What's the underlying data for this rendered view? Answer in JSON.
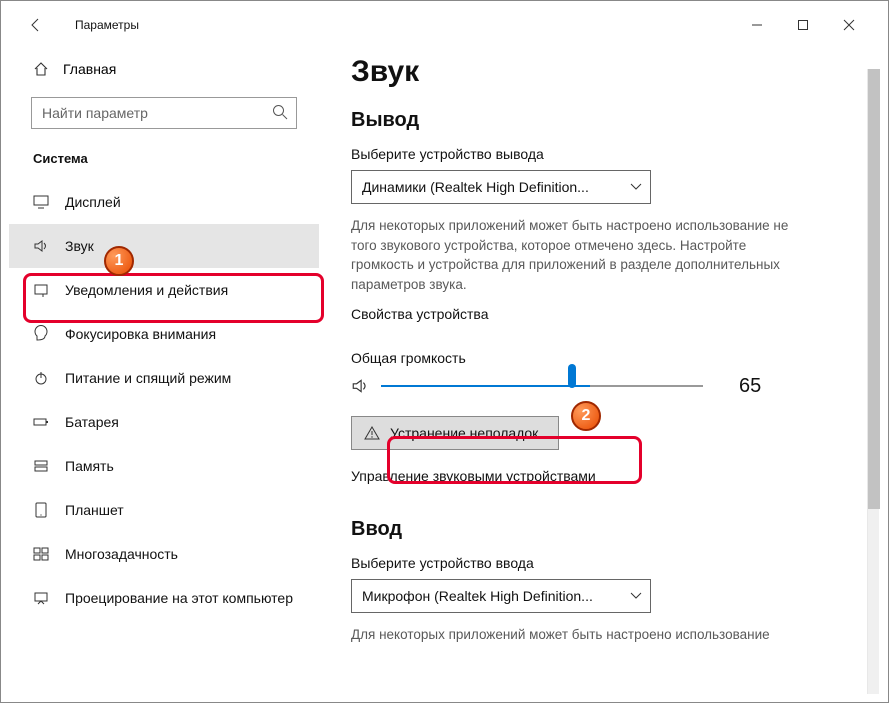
{
  "window": {
    "title": "Параметры"
  },
  "sidebar": {
    "home": "Главная",
    "search_placeholder": "Найти параметр",
    "section": "Система",
    "items": [
      {
        "label": "Дисплей"
      },
      {
        "label": "Звук"
      },
      {
        "label": "Уведомления и действия"
      },
      {
        "label": "Фокусировка внимания"
      },
      {
        "label": "Питание и спящий режим"
      },
      {
        "label": "Батарея"
      },
      {
        "label": "Память"
      },
      {
        "label": "Планшет"
      },
      {
        "label": "Многозадачность"
      },
      {
        "label": "Проецирование на этот компьютер"
      }
    ]
  },
  "page": {
    "title": "Звук",
    "output": {
      "heading": "Вывод",
      "choose_label": "Выберите устройство вывода",
      "device": "Динамики (Realtek High Definition...",
      "hint": "Для некоторых приложений может быть настроено использование не того звукового устройства, которое отмечено здесь. Настройте громкость и устройства для приложений в разделе дополнительных параметров звука.",
      "props_link": "Свойства устройства",
      "master_volume_label": "Общая громкость",
      "volume_value": "65",
      "troubleshoot": "Устранение неполадок",
      "manage_link": "Управление звуковыми устройствами"
    },
    "input": {
      "heading": "Ввод",
      "choose_label": "Выберите устройство ввода",
      "device": "Микрофон (Realtek High Definition...",
      "hint": "Для некоторых приложений может быть настроено использование"
    }
  },
  "markers": {
    "one": "1",
    "two": "2"
  }
}
